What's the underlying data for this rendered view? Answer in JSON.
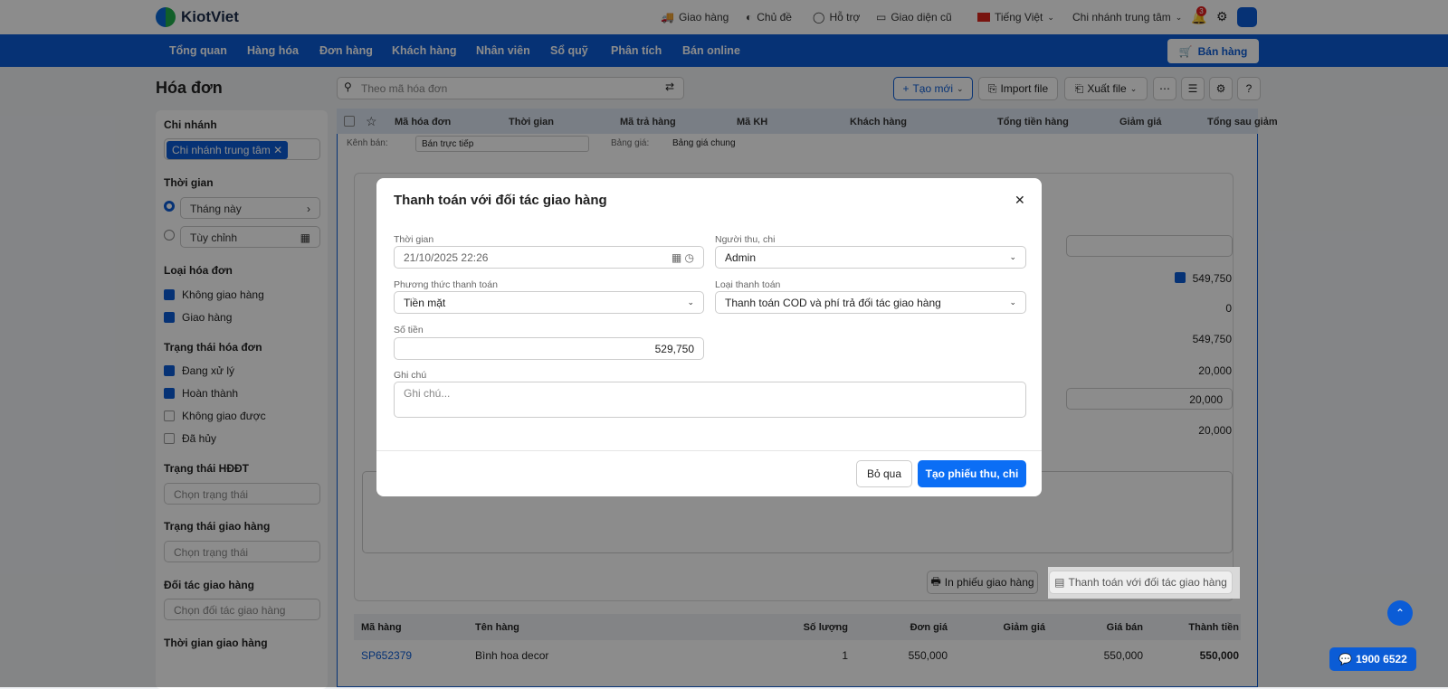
{
  "header": {
    "brand": "KiotViet",
    "links": [
      "Giao hàng",
      "Chủ đề",
      "Hỗ trợ",
      "Giao diện cũ",
      "Tiếng Việt",
      "Chi nhánh trung tâm"
    ],
    "notif_count": "3"
  },
  "nav": {
    "items": [
      "Tổng quan",
      "Hàng hóa",
      "Đơn hàng",
      "Khách hàng",
      "Nhân viên",
      "Sổ quỹ",
      "Phân tích",
      "Bán online"
    ],
    "sell": "Bán hàng"
  },
  "page": {
    "title": "Hóa đơn",
    "search_placeholder": "Theo mã hóa đơn",
    "create": "Tạo mới",
    "import": "Import file",
    "export": "Xuất file"
  },
  "sidebar": {
    "branch_label": "Chi nhánh",
    "branch_tag": "Chi nhánh trung tâm",
    "time_label": "Thời gian",
    "time_opt1": "Tháng này",
    "time_opt2": "Tùy chỉnh",
    "type_label": "Loại hóa đơn",
    "types": [
      "Không giao hàng",
      "Giao hàng"
    ],
    "status_label": "Trạng thái hóa đơn",
    "statuses": [
      "Đang xử lý",
      "Hoàn thành",
      "Không giao được",
      "Đã hủy"
    ],
    "einv_label": "Trạng thái HĐĐT",
    "einv_ph": "Chọn trạng thái",
    "ship_label": "Trạng thái giao hàng",
    "ship_ph": "Chọn trạng thái",
    "partner_label": "Đối tác giao hàng",
    "partner_ph": "Chọn đối tác giao hàng",
    "shiptime_label": "Thời gian giao hàng"
  },
  "table": {
    "columns": [
      "Mã hóa đơn",
      "Thời gian",
      "Mã trả hàng",
      "Mã KH",
      "Khách hàng",
      "Tổng tiền hàng",
      "Giảm giá",
      "Tổng sau giảm"
    ]
  },
  "detail": {
    "channel_label": "Kênh bán:",
    "channel": "Bán trực tiếp",
    "price_label": "Bảng giá:",
    "price": "Bảng giá chung",
    "values": [
      "549,750",
      "0",
      "549,750",
      "20,000",
      "20,000",
      "20,000"
    ],
    "print_btn": "In phiếu giao hàng",
    "pay_btn": "Thanh toán với đối tác giao hàng",
    "items_cols": [
      "Mã hàng",
      "Tên hàng",
      "Số lượng",
      "Đơn giá",
      "Giảm giá",
      "Giá bán",
      "Thành tiền"
    ],
    "item": {
      "code": "SP652379",
      "name": "Bình hoa decor",
      "qty": "1",
      "price": "550,000",
      "discount": "",
      "sale": "550,000",
      "total": "550,000"
    }
  },
  "modal": {
    "title": "Thanh toán với đối tác giao hàng",
    "time_label": "Thời gian",
    "time": "21/10/2025 22:26",
    "payer_label": "Người thu, chi",
    "payer": "Admin",
    "method_label": "Phương thức thanh toán",
    "method": "Tiền mặt",
    "paytype_label": "Loại thanh toán",
    "paytype": "Thanh toán COD và phí trả đối tác giao hàng",
    "amount_label": "Số tiền",
    "amount": "529,750",
    "note_label": "Ghi chú",
    "note_ph": "Ghi chú...",
    "cancel": "Bỏ qua",
    "submit": "Tạo phiếu thu, chi"
  },
  "hotline": "1900 6522"
}
